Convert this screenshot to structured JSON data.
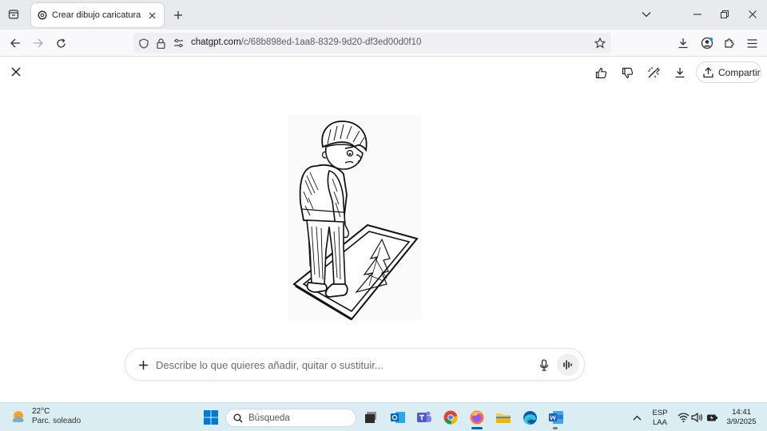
{
  "browser": {
    "tab_title": "Crear dibujo caricatura",
    "url_host": "chatgpt.com",
    "url_path": "/c/68b898ed-1aa8-8329-9d20-df3ed00d0f10"
  },
  "page": {
    "share_label": "Compartir",
    "composer_placeholder": "Describe lo que quieres añadir, quitar o sustituir...",
    "image_description": "cartoon drawing of a sad boy looking at a framed tree on the floor"
  },
  "taskbar": {
    "weather_temp": "22°C",
    "weather_condition": "Parc. soleado",
    "search_placeholder": "Búsqueda",
    "lang_line1": "ESP",
    "lang_line2": "LAA",
    "time": "14:41",
    "date": "3/9/2025"
  },
  "colors": {
    "tabstrip_bg": "#e8eaed",
    "taskbar_bg": "#d9edf2",
    "accent": "#0067c0"
  }
}
